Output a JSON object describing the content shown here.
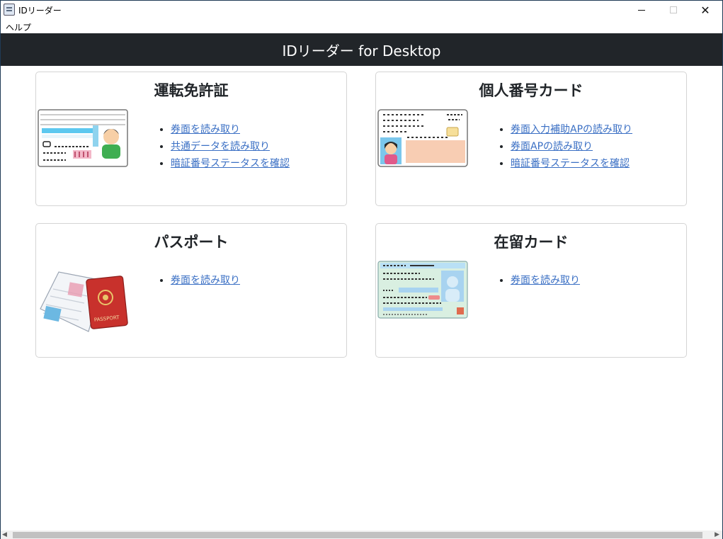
{
  "window": {
    "title": "IDリーダー"
  },
  "menu": {
    "items": [
      "ヘルプ"
    ]
  },
  "navbar": {
    "title": "IDリーダー for Desktop"
  },
  "cards": [
    {
      "title": "運転免許証",
      "icon": "drivers-license-illustration",
      "links": [
        "券面を読み取り",
        "共通データを読み取り",
        "暗証番号ステータスを確認"
      ]
    },
    {
      "title": "個人番号カード",
      "icon": "my-number-card-illustration",
      "links": [
        "券面入力補助APの読み取り",
        "券面APの読み取り",
        "暗証番号ステータスを確認"
      ]
    },
    {
      "title": "パスポート",
      "icon": "passport-illustration",
      "links": [
        "券面を読み取り"
      ]
    },
    {
      "title": "在留カード",
      "icon": "residence-card-illustration",
      "links": [
        "券面を読み取り"
      ]
    }
  ],
  "colors": {
    "navbar": "#212529",
    "link": "#3a6fc4",
    "card_border": "#d4d4d4"
  }
}
